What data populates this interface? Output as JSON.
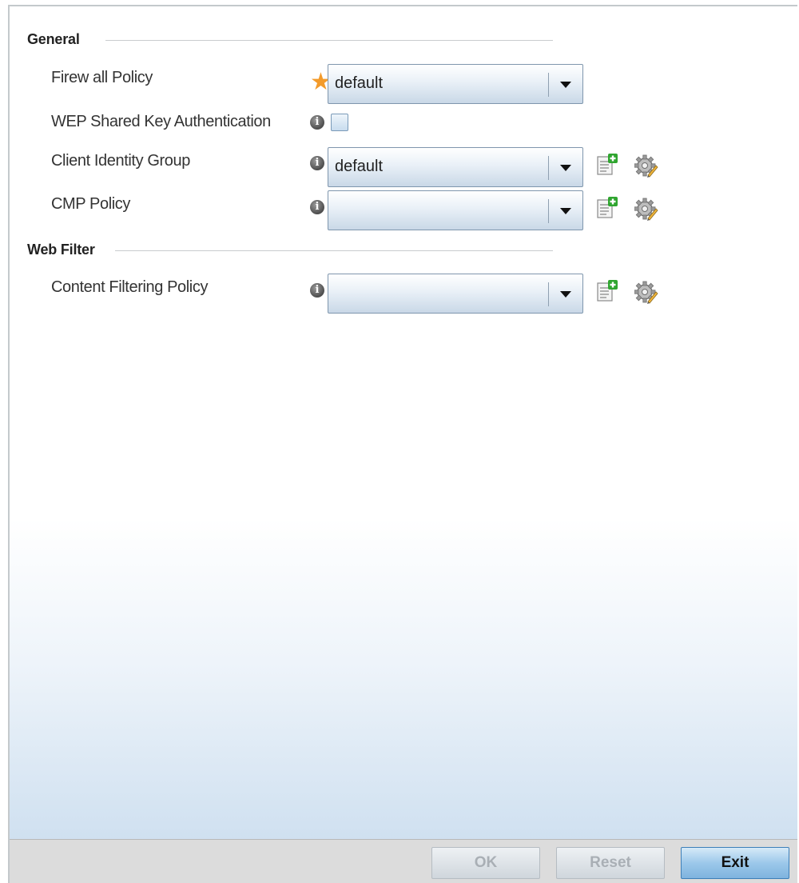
{
  "sections": {
    "general": {
      "title": "General",
      "firewall_policy": {
        "label": "Firew all Policy",
        "value": "default"
      },
      "wep_shared_key": {
        "label": "WEP Shared Key Authentication",
        "checked": false
      },
      "client_identity_group": {
        "label": "Client Identity Group",
        "value": "default"
      },
      "cmp_policy": {
        "label": "CMP Policy",
        "value": ""
      }
    },
    "web_filter": {
      "title": "Web Filter",
      "content_filtering_policy": {
        "label": "Content Filtering Policy",
        "value": ""
      }
    }
  },
  "icons": {
    "required": "required-star-icon",
    "info": "info-icon",
    "create": "create-policy-icon",
    "edit": "edit-policy-gear-icon"
  },
  "footer": {
    "ok_label": "OK",
    "reset_label": "Reset",
    "exit_label": "Exit"
  },
  "colors": {
    "required_star": "#f39b2b",
    "primary_button": "#7fb3de",
    "create_icon_accent": "#2fa52f"
  }
}
